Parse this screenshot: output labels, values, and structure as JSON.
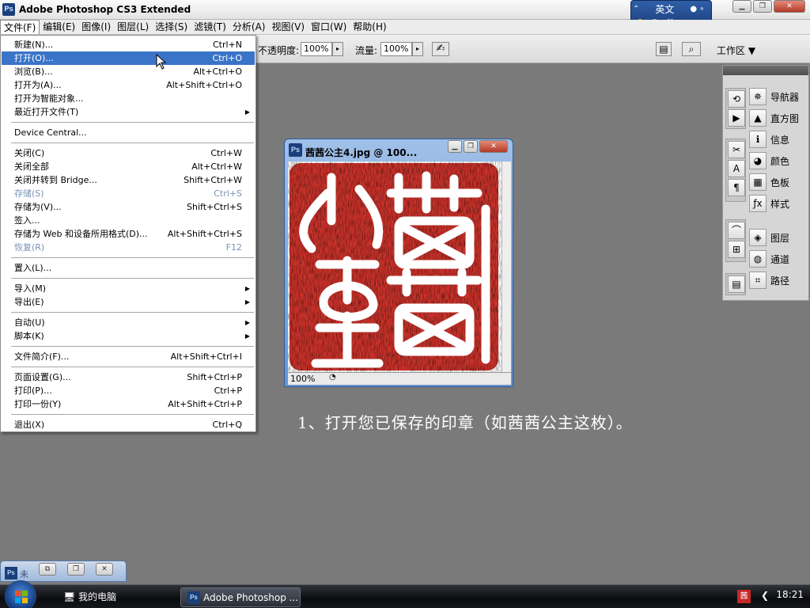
{
  "app": {
    "title": "Adobe Photoshop CS3 Extended",
    "icon_text": "Ps"
  },
  "ime": {
    "lang": "英文",
    "mode": "简"
  },
  "menubar": [
    "文件(F)",
    "编辑(E)",
    "图像(I)",
    "图层(L)",
    "选择(S)",
    "滤镜(T)",
    "分析(A)",
    "视图(V)",
    "窗口(W)",
    "帮助(H)"
  ],
  "options": {
    "opacity_label": "不透明度:",
    "opacity_value": "100%",
    "flow_label": "流量:",
    "flow_value": "100%",
    "workspace_label": "工作区 ▼"
  },
  "file_menu": [
    {
      "label": "新建(N)...",
      "shortcut": "Ctrl+N"
    },
    {
      "label": "打开(O)...",
      "shortcut": "Ctrl+O",
      "highlight": true
    },
    {
      "label": "浏览(B)...",
      "shortcut": "Alt+Ctrl+O"
    },
    {
      "label": "打开为(A)...",
      "shortcut": "Alt+Shift+Ctrl+O"
    },
    {
      "label": "打开为智能对象..."
    },
    {
      "label": "最近打开文件(T)",
      "submenu": true
    },
    {
      "sep": true
    },
    {
      "label": "Device Central..."
    },
    {
      "sep": true
    },
    {
      "label": "关闭(C)",
      "shortcut": "Ctrl+W"
    },
    {
      "label": "关闭全部",
      "shortcut": "Alt+Ctrl+W"
    },
    {
      "label": "关闭并转到 Bridge...",
      "shortcut": "Shift+Ctrl+W"
    },
    {
      "label": "存储(S)",
      "shortcut": "Ctrl+S",
      "disabled": true
    },
    {
      "label": "存储为(V)...",
      "shortcut": "Shift+Ctrl+S"
    },
    {
      "label": "签入..."
    },
    {
      "label": "存储为 Web 和设备所用格式(D)...",
      "shortcut": "Alt+Shift+Ctrl+S"
    },
    {
      "label": "恢复(R)",
      "shortcut": "F12",
      "disabled": true
    },
    {
      "sep": true
    },
    {
      "label": "置入(L)..."
    },
    {
      "sep": true
    },
    {
      "label": "导入(M)",
      "submenu": true
    },
    {
      "label": "导出(E)",
      "submenu": true
    },
    {
      "sep": true
    },
    {
      "label": "自动(U)",
      "submenu": true
    },
    {
      "label": "脚本(K)",
      "submenu": true
    },
    {
      "sep": true
    },
    {
      "label": "文件简介(F)...",
      "shortcut": "Alt+Shift+Ctrl+I"
    },
    {
      "sep": true
    },
    {
      "label": "页面设置(G)...",
      "shortcut": "Shift+Ctrl+P"
    },
    {
      "label": "打印(P)...",
      "shortcut": "Ctrl+P"
    },
    {
      "label": "打印一份(Y)",
      "shortcut": "Alt+Shift+Ctrl+P"
    },
    {
      "sep": true
    },
    {
      "label": "退出(X)",
      "shortcut": "Ctrl+Q"
    }
  ],
  "document": {
    "title": "茜茜公主4.jpg @ 100...",
    "zoom": "100%",
    "seal_color": "#c9322a"
  },
  "caption": "1、打开您已保存的印章（如茜茜公主这枚）。",
  "panels": [
    {
      "label": "导航器",
      "icon": "navigator-icon",
      "glyph": "✵"
    },
    {
      "label": "直方图",
      "icon": "histogram-icon",
      "glyph": "▲"
    },
    {
      "label": "信息",
      "icon": "info-icon",
      "glyph": "ℹ"
    },
    {
      "label": "颜色",
      "icon": "color-icon",
      "glyph": "◕"
    },
    {
      "label": "色板",
      "icon": "swatches-icon",
      "glyph": "▦"
    },
    {
      "label": "样式",
      "icon": "styles-icon",
      "glyph": "ƒx"
    },
    {
      "label": "图层",
      "icon": "layers-icon",
      "glyph": "◈"
    },
    {
      "label": "通道",
      "icon": "channels-icon",
      "glyph": "◍"
    },
    {
      "label": "路径",
      "icon": "paths-icon",
      "glyph": "⌗"
    }
  ],
  "minimized": {
    "label": "未"
  },
  "taskbar": {
    "computer": "我的电脑",
    "photoshop": "Adobe Photoshop ...",
    "time": "18:21"
  }
}
